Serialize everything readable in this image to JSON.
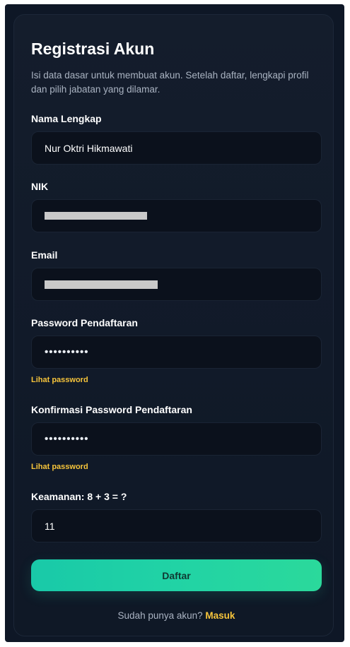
{
  "form": {
    "title": "Registrasi Akun",
    "description": "Isi data dasar untuk membuat akun. Setelah daftar, lengkapi profil dan pilih jabatan yang dilamar.",
    "fields": {
      "name": {
        "label": "Nama Lengkap",
        "value": "Nur Oktri Hikmawati"
      },
      "nik": {
        "label": "NIK"
      },
      "email": {
        "label": "Email"
      },
      "password": {
        "label": "Password Pendaftaran",
        "value": "••••••••••",
        "toggle_label": "Lihat password"
      },
      "confirm": {
        "label": "Konfirmasi Password Pendaftaran",
        "value": "••••••••••",
        "toggle_label": "Lihat password"
      },
      "captcha": {
        "label": "Keamanan: 8 + 3 = ?",
        "value": "11"
      }
    },
    "submit_label": "Daftar",
    "footer": {
      "prompt": "Sudah punya akun?",
      "link": "Masuk"
    }
  }
}
